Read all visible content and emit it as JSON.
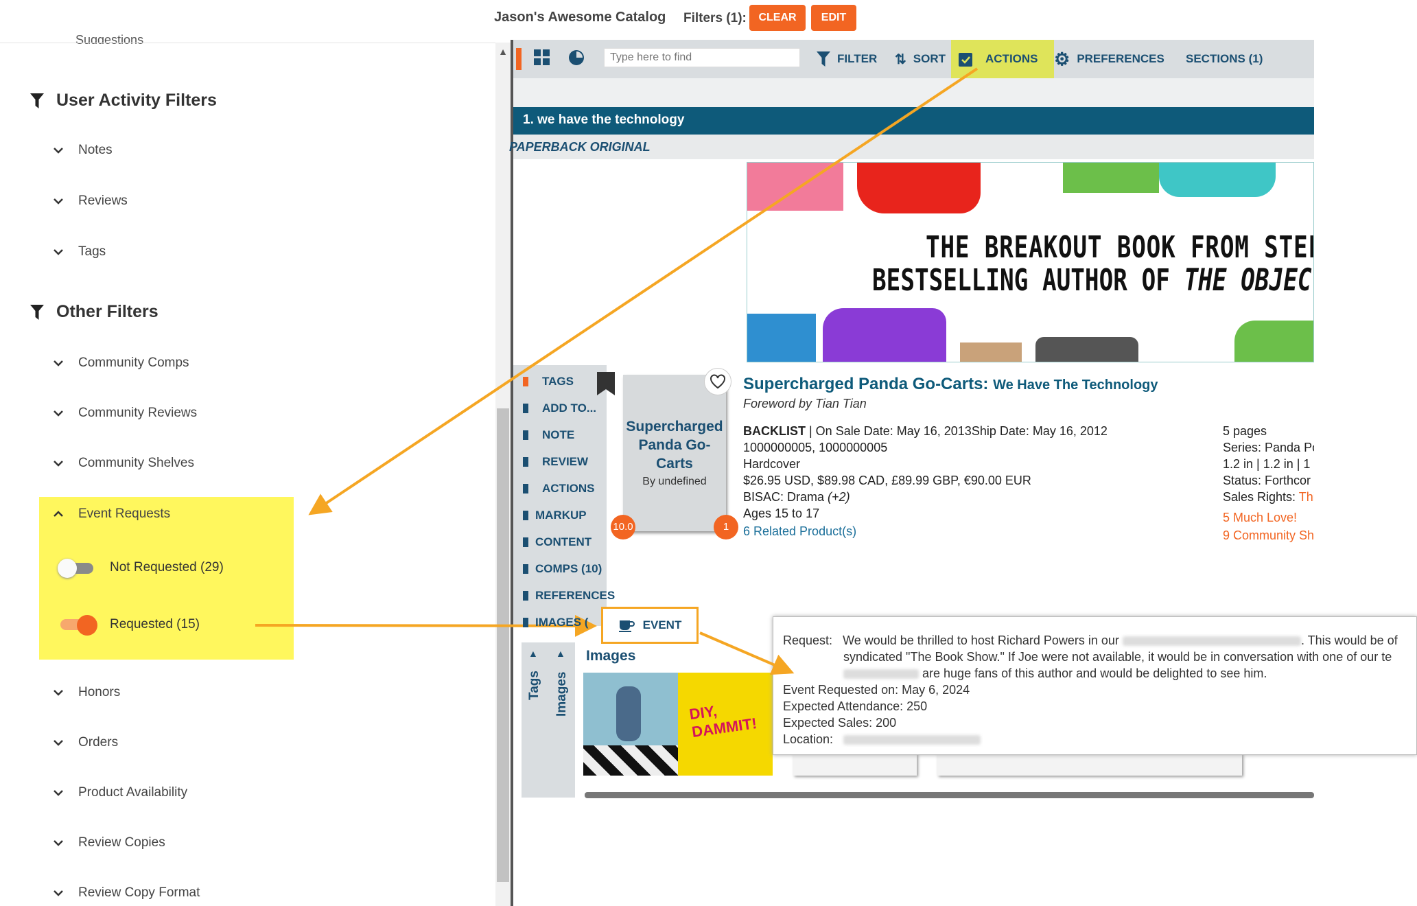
{
  "header": {
    "catalog_title": "Jason's Awesome Catalog",
    "filters_label": "Filters (1):",
    "clear_label": "CLEAR",
    "edit_label": "EDIT"
  },
  "sidebar": {
    "partial_item": "Suggestions",
    "user_activity": {
      "title": "User Activity Filters",
      "items": [
        "Notes",
        "Reviews",
        "Tags"
      ]
    },
    "other": {
      "title": "Other Filters",
      "items_before": [
        "Community Comps",
        "Community Reviews",
        "Community Shelves"
      ],
      "event_requests": {
        "label": "Event Requests",
        "options": [
          {
            "label": "Not Requested (29)",
            "on": false
          },
          {
            "label": "Requested (15)",
            "on": true
          }
        ]
      },
      "items_after": [
        "Honors",
        "Orders",
        "Product Availability",
        "Review Copies",
        "Review Copy Format"
      ]
    }
  },
  "toolbar": {
    "search_placeholder": "Type here to find",
    "filter": "FILTER",
    "sort": "SORT",
    "actions": "ACTIONS",
    "preferences": "PREFERENCES",
    "sections": "SECTIONS (1)"
  },
  "section": {
    "title": "1. we have the technology",
    "format": "PAPERBACK ORIGINAL"
  },
  "banner": {
    "line1": "THE BREAKOUT BOOK FROM STEF",
    "line2a": "BESTSELLING AUTHOR OF ",
    "line2b": "THE OBJECT"
  },
  "actions_list": [
    "TAGS",
    "ADD TO...",
    "NOTE",
    "REVIEW",
    "ACTIONS",
    "MARKUP",
    "CONTENT",
    "COMPS (10)",
    "REFERENCES",
    "IMAGES ("
  ],
  "card": {
    "title": "Supercharged Panda Go-Carts",
    "by": "By undefined",
    "badge_left": "10.0",
    "badge_right": "1"
  },
  "product": {
    "title": "Supercharged Panda Go-Carts:",
    "subtitle": "We Have The Technology",
    "foreword": "Foreword by Tian Tian",
    "status": "BACKLIST",
    "dates": " | On Sale Date: May 16, 2013Ship Date: May 16, 2012",
    "isbns": "1000000005, 1000000005",
    "format": "Hardcover",
    "prices": "$26.95 USD, $89.98 CAD, £89.99 GBP, €90.00 EUR",
    "bisac": "BISAC: Drama",
    "bisac_more": "(+2)",
    "ages": "Ages 15 to 17",
    "related": "6 Related Product(s)",
    "pages": "5 pages",
    "series": "Series: Panda Po",
    "dims": "1.2 in | 1.2 in | 1",
    "pstatus": "Status: Forthcor",
    "rights_label": "Sales Rights: ",
    "rights_value": "Thi",
    "love": "5 Much Love!",
    "shelves": "9 Community Sh"
  },
  "event": {
    "label": "EVENT",
    "images_label": "Images",
    "tab_tags": "Tags",
    "tab_images": "Images",
    "img_text": "DIY, DAMMIT!"
  },
  "popup": {
    "request_label": "Request:",
    "request_a": "We would be thrilled to host Richard Powers in our",
    "request_b": ". This would be of",
    "line2": "syndicated \"The Book Show.\" If Joe were not available, it would be in conversation with one of our te",
    "line3": "are huge fans of this author and would be delighted to see him.",
    "requested_on": "Event Requested on:   May 6, 2024",
    "attendance": "Expected Attendance:   250",
    "sales": "Expected Sales:   200",
    "location": "Location:"
  },
  "colors": {
    "accent": "#f26522",
    "navy": "#1b4f72",
    "highlight": "#fff75d",
    "arrow": "#f5a623"
  }
}
